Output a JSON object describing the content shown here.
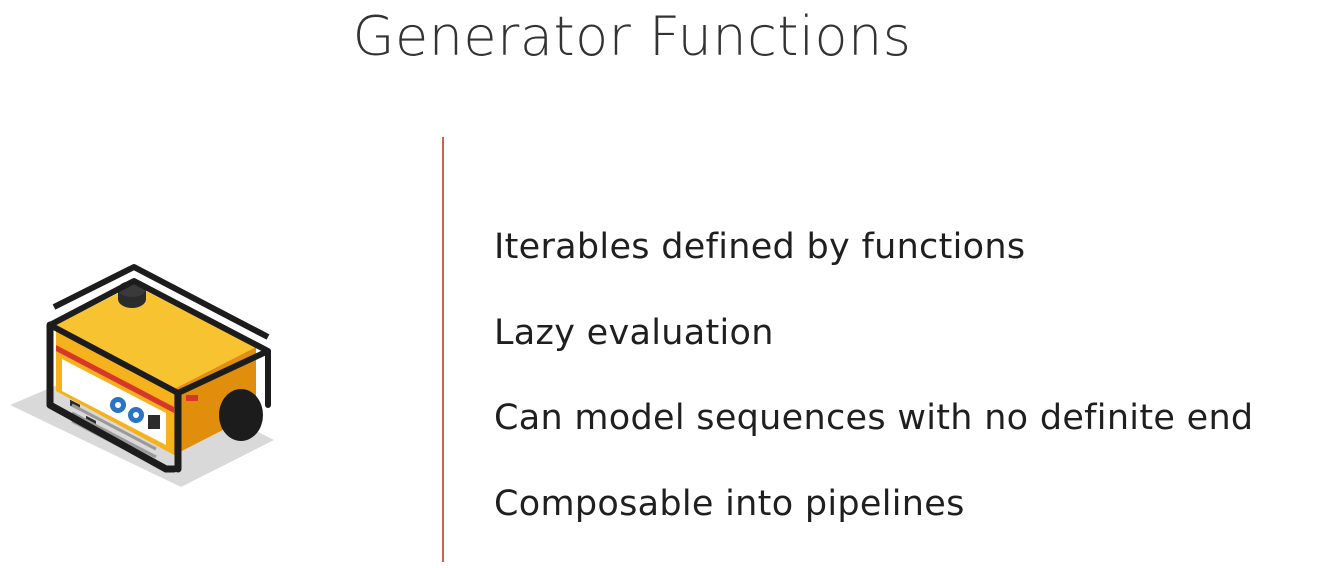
{
  "slide": {
    "title": "Generator Functions",
    "illustration_icon": "generator-icon",
    "bullets": [
      "Iterables defined by functions",
      "Lazy evaluation",
      "Can model sequences with no definite end",
      "Composable into pipelines"
    ]
  },
  "colors": {
    "divider": "#c9634a",
    "generator_body": "#f5b21c",
    "generator_shadow": "#e08e0b",
    "frame": "#1c1c1c"
  }
}
